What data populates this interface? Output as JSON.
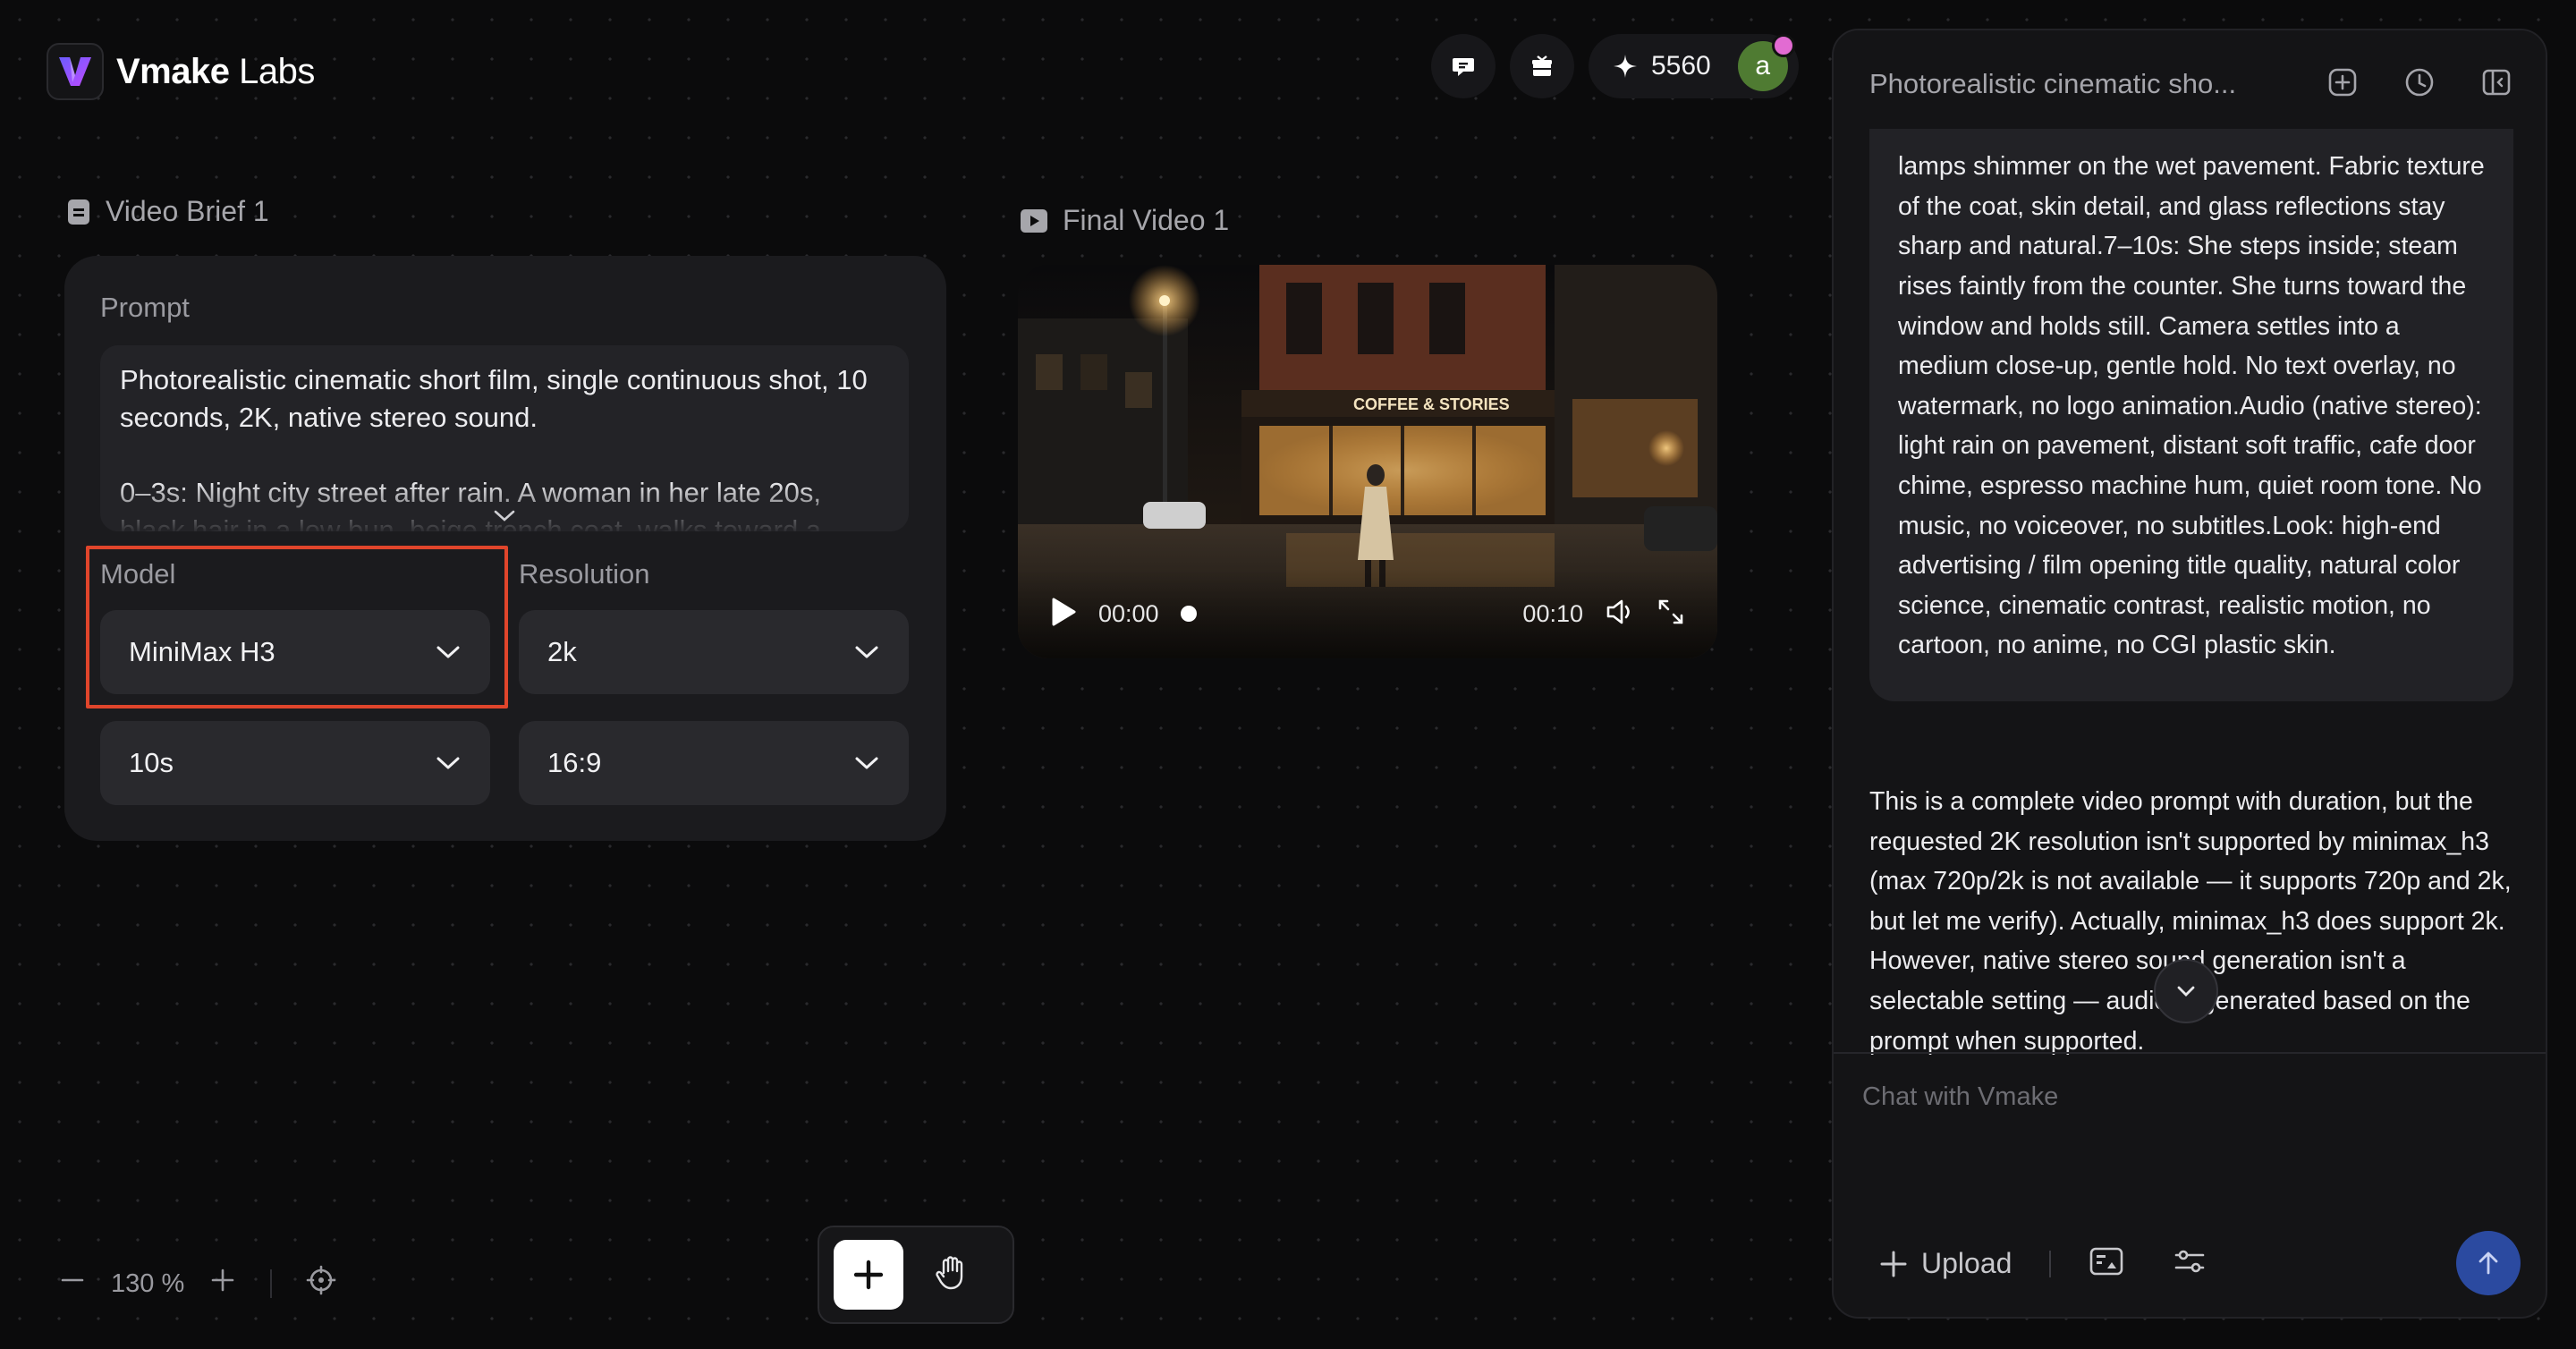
{
  "app": {
    "brand_bold": "Vmake",
    "brand_light": "Labs"
  },
  "topbar": {
    "credits": "5560",
    "avatar_letter": "a",
    "icons": [
      "chat-icon",
      "gift-icon",
      "sparkle-icon"
    ]
  },
  "brief": {
    "title": "Video Brief 1",
    "prompt_label": "Prompt",
    "prompt_text": "Photorealistic cinematic short film, single continuous shot, 10 seconds, 2K, native stereo sound.\n\n0–3s: Night city street after rain. A woman in her late 20s, black hair in a low bun, beige trench coat, walks toward a",
    "model_label": "Model",
    "model_value": "MiniMax H3",
    "resolution_label": "Resolution",
    "resolution_value": "2k",
    "duration_value": "10s",
    "aspect_value": "16:9"
  },
  "video": {
    "title": "Final Video 1",
    "current_time": "00:00",
    "total_time": "00:10",
    "progress": 0,
    "sign_text": "COFFEE & STORIES"
  },
  "chat": {
    "title": "Photorealistic cinematic sho...",
    "user_message": "lamps shimmer on the wet pavement. Fabric texture of the coat, skin detail, and glass reflections stay sharp and natural.7–10s: She steps inside; steam rises faintly from the counter. She turns toward the window and holds still. Camera settles into a medium close-up, gentle hold. No text overlay, no watermark, no logo animation.Audio (native stereo): light rain on pavement, distant soft traffic, cafe door chime, espresso machine hum, quiet room tone. No music, no voiceover, no subtitles.Look: high-end advertising / film opening title quality, natural color science, cinematic contrast, realistic motion, no cartoon, no anime, no CGI plastic skin.",
    "assistant_message": "This is a complete video prompt with duration, but the requested 2K resolution isn't supported by minimax_h3 (max 720p/2k is not available — it supports 720p and 2k, but let me verify). Actually, minimax_h3 does support 2k. However, native stereo sound generation isn't a selectable setting — audio is generated based on the prompt when supported.",
    "input_placeholder": "Chat with Vmake",
    "upload_label": "Upload"
  },
  "canvas": {
    "zoom_value": "130",
    "zoom_unit": "%"
  },
  "colors": {
    "accent_send": "#2b4aa0",
    "highlight": "#e0452b",
    "avatar": "#4f7b32"
  }
}
